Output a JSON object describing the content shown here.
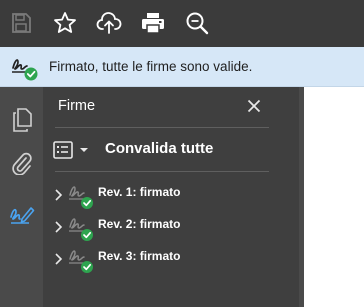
{
  "toolbar": {
    "buttons": [
      {
        "icon": "save-icon",
        "enabled": false
      },
      {
        "icon": "bookmark-star-icon",
        "enabled": true
      },
      {
        "icon": "cloud-upload-icon",
        "enabled": true
      },
      {
        "icon": "print-icon",
        "enabled": true
      },
      {
        "icon": "zoom-search-icon",
        "enabled": true
      }
    ]
  },
  "signature_bar": {
    "icon": "signature-valid-icon",
    "text": "Firmato, tutte le firme sono valide."
  },
  "rail": {
    "items": [
      {
        "icon": "pages-icon",
        "active": false
      },
      {
        "icon": "attachment-icon",
        "active": false
      },
      {
        "icon": "signature-pen-icon",
        "active": true
      }
    ]
  },
  "panel": {
    "title": "Firme",
    "validate_all_label": "Convalida tutte",
    "revisions": [
      {
        "label": "Rev. 1: firmato",
        "status": "valid"
      },
      {
        "label": "Rev. 2: firmato",
        "status": "valid"
      },
      {
        "label": "Rev. 3: firmato",
        "status": "valid"
      }
    ]
  },
  "colors": {
    "toolbar_bg": "#3b3b3b",
    "status_bar_bg": "#d6e7f7",
    "panel_bg": "#3f3f3f",
    "valid_green": "#2ea44f",
    "active_blue": "#4aa3f0"
  }
}
